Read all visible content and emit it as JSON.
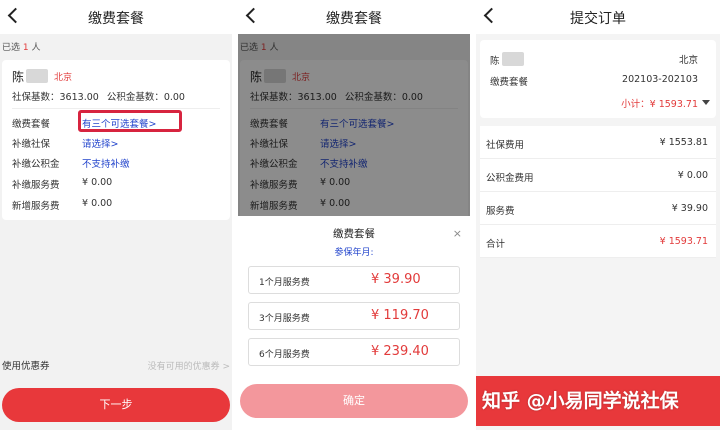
{
  "panel1": {
    "nav_title": "缴费套餐",
    "selected_prefix": "已选",
    "selected_count": "1",
    "selected_suffix": "人",
    "person_name": "陈",
    "person_city": "北京",
    "social_base_label": "社保基数：",
    "social_base_value": "3613.00",
    "fund_base_label": "公积金基数：",
    "fund_base_value": "0.00",
    "rows": [
      {
        "label": "缴费套餐",
        "value": "有三个可选套餐>"
      },
      {
        "label": "补缴社保",
        "value": "请选择>"
      },
      {
        "label": "补缴公积金",
        "value": "不支持补缴"
      },
      {
        "label": "补缴服务费",
        "value": "¥ 0.00"
      },
      {
        "label": "新增服务费",
        "value": "¥ 0.00"
      }
    ],
    "coupon_label": "使用优惠券",
    "coupon_value": "没有可用的优惠券 >",
    "next_button": "下一步",
    "colors": {
      "accent": "#e8383b",
      "link": "#2244cc",
      "highlight_box": "#d7243f"
    }
  },
  "panel2": {
    "nav_title": "缴费套餐",
    "sheet_title": "缴费套餐",
    "sheet_subtitle": "参保年月:",
    "close_icon": "×",
    "options": [
      {
        "label": "1个月服务费",
        "price": "¥ 39.90"
      },
      {
        "label": "3个月服务费",
        "price": "¥ 119.70"
      },
      {
        "label": "6个月服务费",
        "price": "¥ 239.40"
      }
    ],
    "confirm_button": "确定"
  },
  "panel3": {
    "nav_title": "提交订单",
    "person_name": "陈",
    "person_city": "北京",
    "plan_label": "缴费套餐",
    "plan_value": "202103-202103",
    "subtotal": "小计：¥ 1593.71",
    "fees": [
      {
        "label": "社保费用",
        "value": "¥ 1553.81"
      },
      {
        "label": "公积金费用",
        "value": "¥ 0.00"
      },
      {
        "label": "服务费",
        "value": "¥ 39.90"
      },
      {
        "label": "合计",
        "value": "¥ 1593.71"
      }
    ],
    "watermark": "知乎 @小易同学说社保"
  }
}
